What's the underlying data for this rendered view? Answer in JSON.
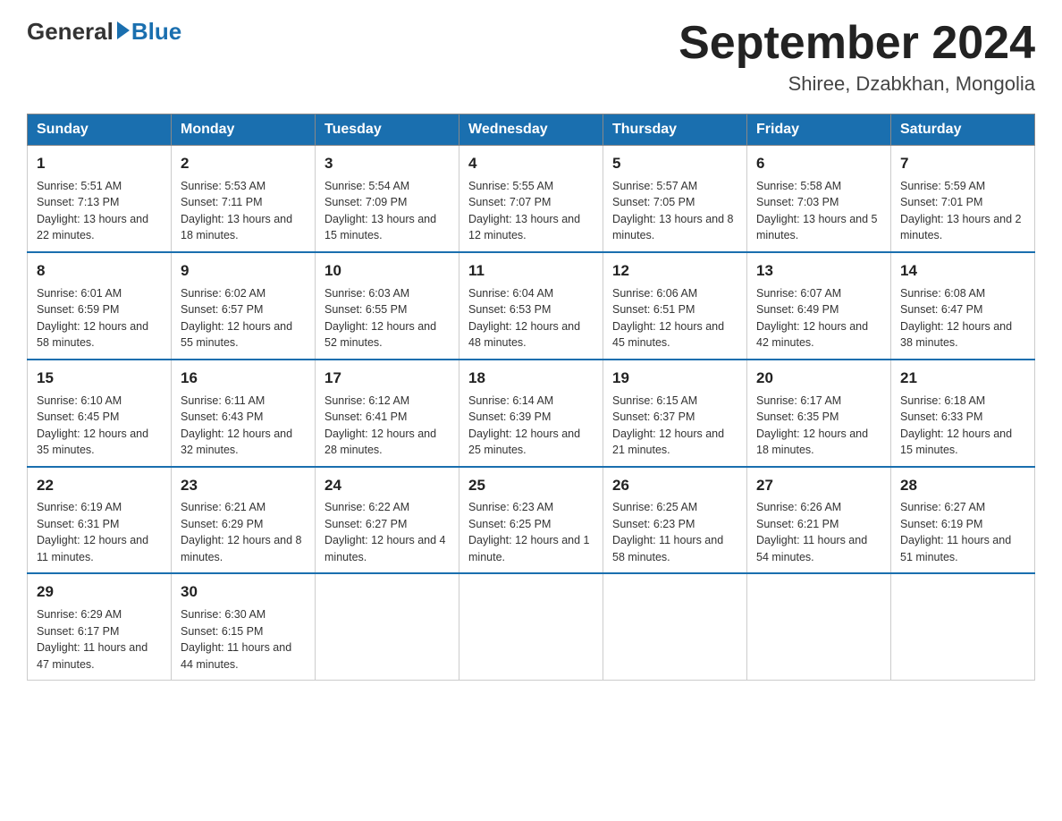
{
  "header": {
    "logo_general": "General",
    "logo_blue": "Blue",
    "month_title": "September 2024",
    "subtitle": "Shiree, Dzabkhan, Mongolia"
  },
  "days_of_week": [
    "Sunday",
    "Monday",
    "Tuesday",
    "Wednesday",
    "Thursday",
    "Friday",
    "Saturday"
  ],
  "weeks": [
    [
      {
        "day": "1",
        "sunrise": "5:51 AM",
        "sunset": "7:13 PM",
        "daylight": "13 hours and 22 minutes."
      },
      {
        "day": "2",
        "sunrise": "5:53 AM",
        "sunset": "7:11 PM",
        "daylight": "13 hours and 18 minutes."
      },
      {
        "day": "3",
        "sunrise": "5:54 AM",
        "sunset": "7:09 PM",
        "daylight": "13 hours and 15 minutes."
      },
      {
        "day": "4",
        "sunrise": "5:55 AM",
        "sunset": "7:07 PM",
        "daylight": "13 hours and 12 minutes."
      },
      {
        "day": "5",
        "sunrise": "5:57 AM",
        "sunset": "7:05 PM",
        "daylight": "13 hours and 8 minutes."
      },
      {
        "day": "6",
        "sunrise": "5:58 AM",
        "sunset": "7:03 PM",
        "daylight": "13 hours and 5 minutes."
      },
      {
        "day": "7",
        "sunrise": "5:59 AM",
        "sunset": "7:01 PM",
        "daylight": "13 hours and 2 minutes."
      }
    ],
    [
      {
        "day": "8",
        "sunrise": "6:01 AM",
        "sunset": "6:59 PM",
        "daylight": "12 hours and 58 minutes."
      },
      {
        "day": "9",
        "sunrise": "6:02 AM",
        "sunset": "6:57 PM",
        "daylight": "12 hours and 55 minutes."
      },
      {
        "day": "10",
        "sunrise": "6:03 AM",
        "sunset": "6:55 PM",
        "daylight": "12 hours and 52 minutes."
      },
      {
        "day": "11",
        "sunrise": "6:04 AM",
        "sunset": "6:53 PM",
        "daylight": "12 hours and 48 minutes."
      },
      {
        "day": "12",
        "sunrise": "6:06 AM",
        "sunset": "6:51 PM",
        "daylight": "12 hours and 45 minutes."
      },
      {
        "day": "13",
        "sunrise": "6:07 AM",
        "sunset": "6:49 PM",
        "daylight": "12 hours and 42 minutes."
      },
      {
        "day": "14",
        "sunrise": "6:08 AM",
        "sunset": "6:47 PM",
        "daylight": "12 hours and 38 minutes."
      }
    ],
    [
      {
        "day": "15",
        "sunrise": "6:10 AM",
        "sunset": "6:45 PM",
        "daylight": "12 hours and 35 minutes."
      },
      {
        "day": "16",
        "sunrise": "6:11 AM",
        "sunset": "6:43 PM",
        "daylight": "12 hours and 32 minutes."
      },
      {
        "day": "17",
        "sunrise": "6:12 AM",
        "sunset": "6:41 PM",
        "daylight": "12 hours and 28 minutes."
      },
      {
        "day": "18",
        "sunrise": "6:14 AM",
        "sunset": "6:39 PM",
        "daylight": "12 hours and 25 minutes."
      },
      {
        "day": "19",
        "sunrise": "6:15 AM",
        "sunset": "6:37 PM",
        "daylight": "12 hours and 21 minutes."
      },
      {
        "day": "20",
        "sunrise": "6:17 AM",
        "sunset": "6:35 PM",
        "daylight": "12 hours and 18 minutes."
      },
      {
        "day": "21",
        "sunrise": "6:18 AM",
        "sunset": "6:33 PM",
        "daylight": "12 hours and 15 minutes."
      }
    ],
    [
      {
        "day": "22",
        "sunrise": "6:19 AM",
        "sunset": "6:31 PM",
        "daylight": "12 hours and 11 minutes."
      },
      {
        "day": "23",
        "sunrise": "6:21 AM",
        "sunset": "6:29 PM",
        "daylight": "12 hours and 8 minutes."
      },
      {
        "day": "24",
        "sunrise": "6:22 AM",
        "sunset": "6:27 PM",
        "daylight": "12 hours and 4 minutes."
      },
      {
        "day": "25",
        "sunrise": "6:23 AM",
        "sunset": "6:25 PM",
        "daylight": "12 hours and 1 minute."
      },
      {
        "day": "26",
        "sunrise": "6:25 AM",
        "sunset": "6:23 PM",
        "daylight": "11 hours and 58 minutes."
      },
      {
        "day": "27",
        "sunrise": "6:26 AM",
        "sunset": "6:21 PM",
        "daylight": "11 hours and 54 minutes."
      },
      {
        "day": "28",
        "sunrise": "6:27 AM",
        "sunset": "6:19 PM",
        "daylight": "11 hours and 51 minutes."
      }
    ],
    [
      {
        "day": "29",
        "sunrise": "6:29 AM",
        "sunset": "6:17 PM",
        "daylight": "11 hours and 47 minutes."
      },
      {
        "day": "30",
        "sunrise": "6:30 AM",
        "sunset": "6:15 PM",
        "daylight": "11 hours and 44 minutes."
      },
      null,
      null,
      null,
      null,
      null
    ]
  ],
  "labels": {
    "sunrise": "Sunrise: ",
    "sunset": "Sunset: ",
    "daylight": "Daylight: "
  }
}
